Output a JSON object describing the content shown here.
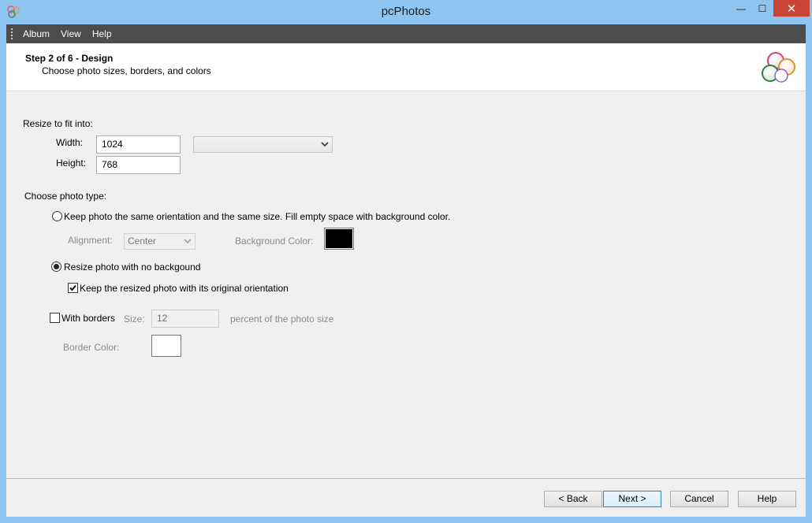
{
  "window": {
    "title": "pcPhotos",
    "close_glyph": "✕",
    "min_glyph": "—",
    "max_glyph": "☐"
  },
  "menu": {
    "items": [
      "Album",
      "View",
      "Help"
    ]
  },
  "header": {
    "step_title": "Step 2 of 6 - Design",
    "step_subtitle": "Choose photo sizes, borders, and colors"
  },
  "resize": {
    "label": "Resize to fit into:",
    "width_label": "Width:",
    "width_value": "1024",
    "height_label": "Height:",
    "height_value": "768",
    "preset_value": ""
  },
  "photo_type": {
    "label": "Choose photo type:",
    "option_keep": "Keep photo the same orientation and the same size. Fill empty space with background color.",
    "alignment_label": "Alignment:",
    "alignment_value": "Center",
    "bg_color_label": "Background Color:",
    "bg_color": "#000000",
    "option_resize": "Resize photo with no backgound",
    "keep_orientation_label": "Keep the resized photo with its original orientation",
    "selected": "resize",
    "keep_orientation_checked": true
  },
  "borders": {
    "label": "With borders",
    "checked": false,
    "size_label": "Size:",
    "size_value": "12",
    "size_suffix": "percent of the photo size",
    "color_label": "Border Color:",
    "border_color": "#ffffff"
  },
  "footer": {
    "back_label": "< Back",
    "next_label": "Next >",
    "cancel_label": "Cancel",
    "help_label": "Help"
  },
  "icons": [
    "app-logo-icon",
    "chevron-down-icon",
    "checkmark-icon",
    "grip-icon"
  ]
}
